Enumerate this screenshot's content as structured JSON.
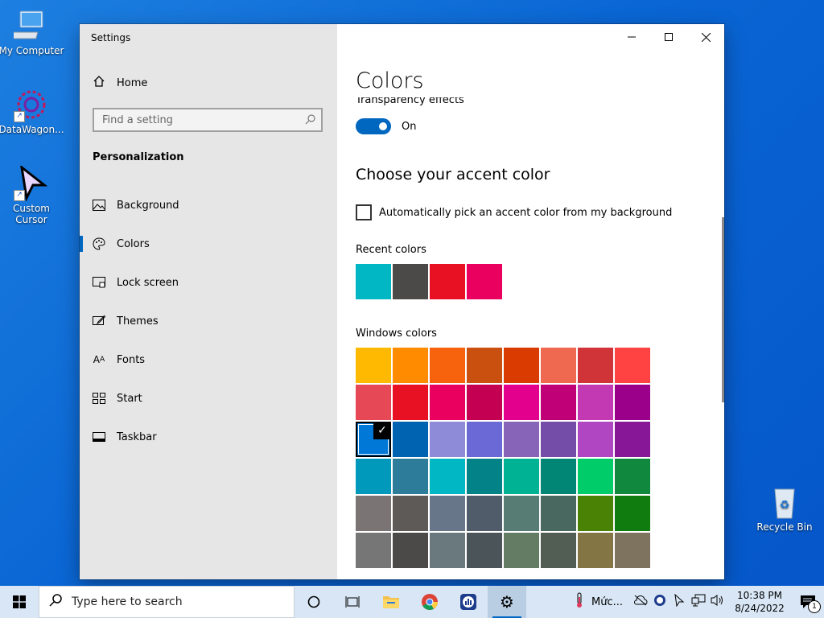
{
  "desktop": {
    "icons": [
      {
        "label": "My Computer"
      },
      {
        "label": "DataWagon..."
      },
      {
        "label": "Custom Cursor"
      },
      {
        "label": "Recycle Bin"
      }
    ]
  },
  "window": {
    "title": "Settings",
    "controls": {
      "minimize": "—",
      "maximize": "☐",
      "close": "✕"
    }
  },
  "sidebar": {
    "home_label": "Home",
    "search_placeholder": "Find a setting",
    "section_title": "Personalization",
    "items": [
      {
        "label": "Background",
        "icon": "picture-icon"
      },
      {
        "label": "Colors",
        "icon": "palette-icon",
        "active": true
      },
      {
        "label": "Lock screen",
        "icon": "lock-screen-icon"
      },
      {
        "label": "Themes",
        "icon": "brush-icon"
      },
      {
        "label": "Fonts",
        "icon": "font-icon"
      },
      {
        "label": "Start",
        "icon": "start-tiles-icon"
      },
      {
        "label": "Taskbar",
        "icon": "taskbar-icon"
      }
    ]
  },
  "main": {
    "title": "Colors",
    "transparency_label": "Transparency effects",
    "transparency_state": "On",
    "accent_heading": "Choose your accent color",
    "auto_pick_label": "Automatically pick an accent color from my background",
    "recent_heading": "Recent colors",
    "recent_colors": [
      "#00b7c3",
      "#4c4a48",
      "#e81123",
      "#ea005e"
    ],
    "windows_heading": "Windows colors",
    "windows_colors": [
      [
        "#ffb900",
        "#ff8c00",
        "#f7630c",
        "#ca5010",
        "#da3b01",
        "#ef6950",
        "#d13438",
        "#ff4343"
      ],
      [
        "#e74856",
        "#e81123",
        "#ea005e",
        "#c30052",
        "#e3008c",
        "#bf0077",
        "#c239b3",
        "#9a0089"
      ],
      [
        "#0078d7",
        "#0063b1",
        "#8e8cd8",
        "#6b69d6",
        "#8764b8",
        "#744da9",
        "#b146c2",
        "#881798"
      ],
      [
        "#0099bc",
        "#2d7d9a",
        "#00b7c3",
        "#038387",
        "#00b294",
        "#018574",
        "#00cc6a",
        "#10893e"
      ],
      [
        "#7a7574",
        "#5d5a58",
        "#68768a",
        "#515c6b",
        "#567c73",
        "#486860",
        "#498205",
        "#107c10"
      ],
      [
        "#767676",
        "#4c4a48",
        "#69797e",
        "#4a5459",
        "#647c64",
        "#525e54",
        "#847545",
        "#7e735f"
      ]
    ],
    "selected_color": "#0078d7"
  },
  "taskbar": {
    "search_placeholder": "Type here to search",
    "tray_app_label": "Mức...",
    "time": "10:38 PM",
    "date": "8/24/2022",
    "notification_count": "1"
  }
}
